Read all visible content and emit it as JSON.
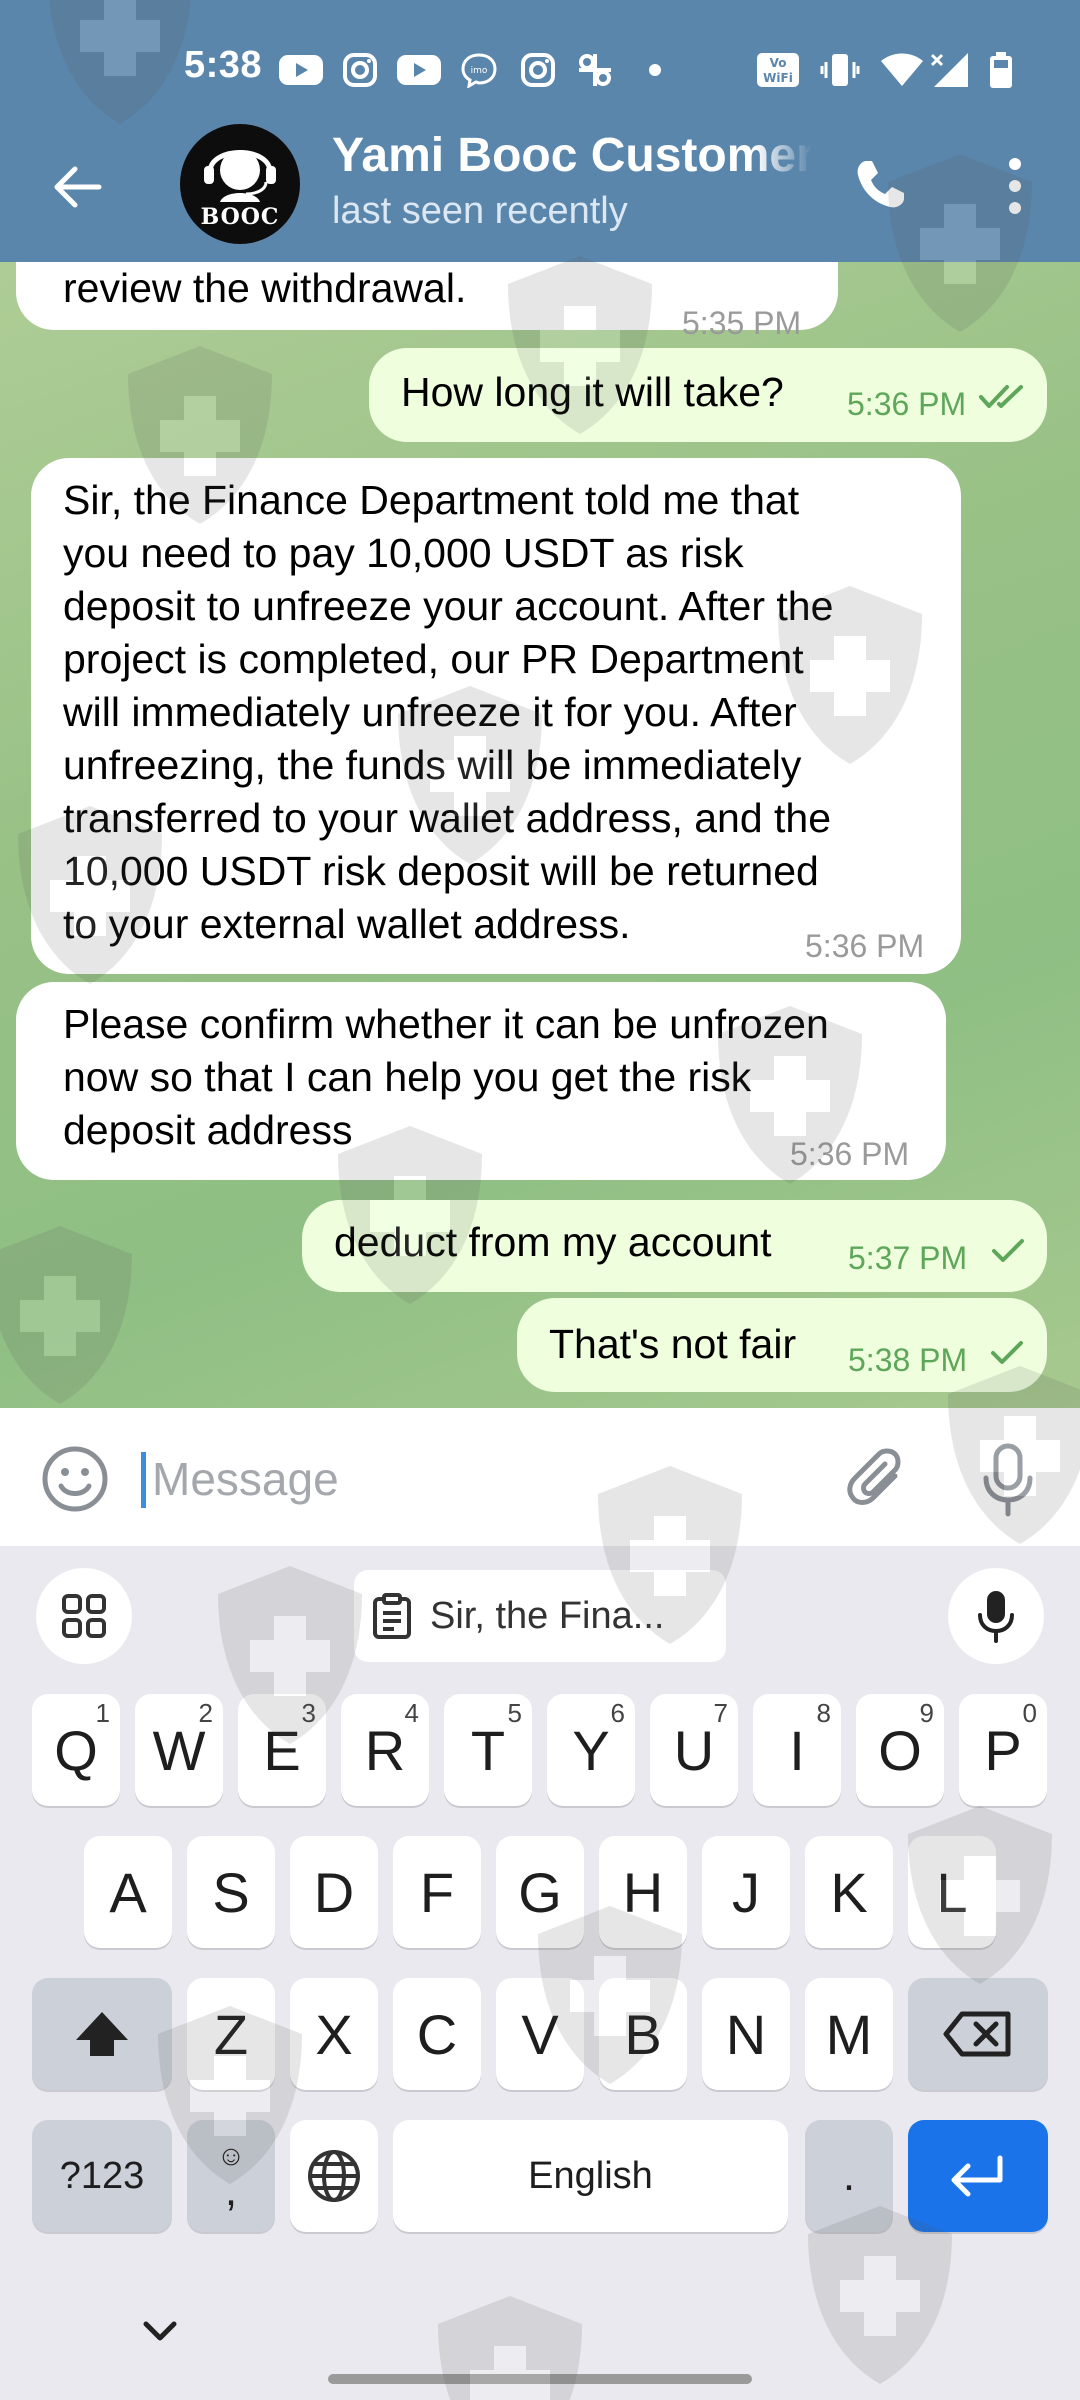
{
  "status_bar": {
    "time": "5:38",
    "icons": [
      "youtube-icon",
      "instagram-icon",
      "youtube-icon",
      "imo-icon",
      "instagram-icon",
      "app-icon",
      "dot-icon",
      "wifi-calling-icon",
      "vibrate-icon",
      "wifi-icon",
      "signal-icon",
      "battery-icon"
    ]
  },
  "header": {
    "title": "Yami Booc Customer",
    "subtitle": "last seen recently",
    "avatar_text": "BOOC"
  },
  "messages": [
    {
      "direction": "in",
      "text": "review the withdrawal.",
      "time": "5:35 PM"
    },
    {
      "direction": "out",
      "text": "How long it will take?",
      "time": "5:36 PM",
      "status": "read"
    },
    {
      "direction": "in",
      "lines": [
        "Sir, the Finance Department told me that",
        "you need to pay 10,000 USDT as risk",
        "deposit to unfreeze your account. After the",
        "project is completed, our PR Department",
        "will immediately unfreeze it for you. After",
        "unfreezing, the funds will be immediately",
        "transferred to your wallet address, and the",
        "10,000 USDT risk deposit will be returned",
        "to your external wallet address."
      ],
      "time": "5:36 PM"
    },
    {
      "direction": "in",
      "lines": [
        "Please confirm whether it can be unfrozen",
        "now so that I can help you get the risk",
        "deposit address"
      ],
      "time": "5:36 PM"
    },
    {
      "direction": "out",
      "text": "deduct from my account",
      "time": "5:37 PM",
      "status": "sent"
    },
    {
      "direction": "out",
      "text": "That's not fair",
      "time": "5:38 PM",
      "status": "sent"
    }
  ],
  "composer": {
    "placeholder": "Message"
  },
  "keyboard": {
    "clipboard_text": "Sir, the Fina...",
    "row1": [
      {
        "k": "Q",
        "h": "1"
      },
      {
        "k": "W",
        "h": "2"
      },
      {
        "k": "E",
        "h": "3"
      },
      {
        "k": "R",
        "h": "4"
      },
      {
        "k": "T",
        "h": "5"
      },
      {
        "k": "Y",
        "h": "6"
      },
      {
        "k": "U",
        "h": "7"
      },
      {
        "k": "I",
        "h": "8"
      },
      {
        "k": "O",
        "h": "9"
      },
      {
        "k": "P",
        "h": "0"
      }
    ],
    "row2": [
      "A",
      "S",
      "D",
      "F",
      "G",
      "H",
      "J",
      "K",
      "L"
    ],
    "row3": [
      "Z",
      "X",
      "C",
      "V",
      "B",
      "N",
      "M"
    ],
    "symbols_label": "?123",
    "comma_label": ",",
    "emoji_hint": "☺",
    "space_label": "English",
    "period_label": "."
  }
}
